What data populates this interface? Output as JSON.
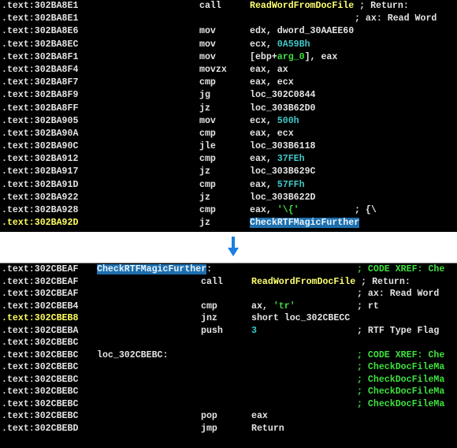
{
  "colors": {
    "background": "#000000",
    "text": "#e4e4e4",
    "function_name": "#ffff70",
    "number": "#40c8c8",
    "comment_green": "#3ee03e",
    "highlight": "#1e6fae",
    "arrow": "#1a7fe0"
  },
  "arrow_icon": "arrow-down-icon",
  "top_listing": [
    {
      "addr": ".text:302BA8E1",
      "mn": "call",
      "ops": [
        {
          "t": "ReadWordFromDocFile",
          "c": "y"
        },
        {
          "t": " ; Return:",
          "c": "w"
        }
      ]
    },
    {
      "addr": ".text:302BA8E1",
      "cm": [
        {
          "t": "; ax: Read Word",
          "c": "w"
        }
      ]
    },
    {
      "addr": ".text:302BA8E6",
      "mn": "mov",
      "ops": [
        {
          "t": "edx, dword_30AAEE60",
          "c": "w"
        }
      ]
    },
    {
      "addr": ".text:302BA8EC",
      "mn": "mov",
      "ops": [
        {
          "t": "ecx, ",
          "c": "w"
        },
        {
          "t": "0A59Bh",
          "c": "cy"
        }
      ]
    },
    {
      "addr": ".text:302BA8F1",
      "mn": "mov",
      "ops": [
        {
          "t": "[ebp+",
          "c": "w"
        },
        {
          "t": "arg_0",
          "c": "g"
        },
        {
          "t": "], eax",
          "c": "w"
        }
      ]
    },
    {
      "addr": ".text:302BA8F4",
      "mn": "movzx",
      "ops": [
        {
          "t": "eax, ax",
          "c": "w"
        }
      ]
    },
    {
      "addr": ".text:302BA8F7",
      "mn": "cmp",
      "ops": [
        {
          "t": "eax, ecx",
          "c": "w"
        }
      ]
    },
    {
      "addr": ".text:302BA8F9",
      "mn": "jg",
      "ops": [
        {
          "t": "loc_302C0844",
          "c": "w"
        }
      ]
    },
    {
      "addr": ".text:302BA8FF",
      "mn": "jz",
      "ops": [
        {
          "t": "loc_303B62D0",
          "c": "w"
        }
      ]
    },
    {
      "addr": ".text:302BA905",
      "mn": "mov",
      "ops": [
        {
          "t": "ecx, ",
          "c": "w"
        },
        {
          "t": "500h",
          "c": "cy"
        }
      ]
    },
    {
      "addr": ".text:302BA90A",
      "mn": "cmp",
      "ops": [
        {
          "t": "eax, ecx",
          "c": "w"
        }
      ]
    },
    {
      "addr": ".text:302BA90C",
      "mn": "jle",
      "ops": [
        {
          "t": "loc_303B6118",
          "c": "w"
        }
      ]
    },
    {
      "addr": ".text:302BA912",
      "mn": "cmp",
      "ops": [
        {
          "t": "eax, ",
          "c": "w"
        },
        {
          "t": "37FEh",
          "c": "cy"
        }
      ]
    },
    {
      "addr": ".text:302BA917",
      "mn": "jz",
      "ops": [
        {
          "t": "loc_303B629C",
          "c": "w"
        }
      ]
    },
    {
      "addr": ".text:302BA91D",
      "mn": "cmp",
      "ops": [
        {
          "t": "eax, ",
          "c": "w"
        },
        {
          "t": "57FFh",
          "c": "cy"
        }
      ]
    },
    {
      "addr": ".text:302BA922",
      "mn": "jz",
      "ops": [
        {
          "t": "loc_303B622D",
          "c": "w"
        }
      ]
    },
    {
      "addr": ".text:302BA928",
      "mn": "cmp",
      "ops": [
        {
          "t": "eax, ",
          "c": "w"
        },
        {
          "t": "'\\{'",
          "c": "g"
        }
      ],
      "cm": [
        {
          "t": "; {\\",
          "c": "w"
        }
      ]
    },
    {
      "addr": ".text:302BA92D",
      "cur": true,
      "mn": "jz",
      "ops": [
        {
          "t": "CheckRTFMagicFurther",
          "c": "hl"
        }
      ]
    }
  ],
  "bottom_listing": [
    {
      "addr": ".text:302CBEAF",
      "lbl": [
        {
          "t": "CheckRTFMagicFurther",
          "c": "hl"
        },
        {
          "t": ":",
          "c": "w"
        }
      ],
      "cm": [
        {
          "t": "; CODE XREF: Che",
          "c": "g"
        }
      ]
    },
    {
      "addr": ".text:302CBEAF",
      "mn": "call",
      "ops": [
        {
          "t": "ReadWordFromDocFile",
          "c": "y"
        },
        {
          "t": " ; Return:",
          "c": "w"
        }
      ]
    },
    {
      "addr": ".text:302CBEAF",
      "cm": [
        {
          "t": "; ax: Read Word",
          "c": "w"
        }
      ]
    },
    {
      "addr": ".text:302CBEB4",
      "mn": "cmp",
      "ops": [
        {
          "t": "ax, ",
          "c": "w"
        },
        {
          "t": "'tr'",
          "c": "g"
        }
      ],
      "cm": [
        {
          "t": "; rt",
          "c": "w"
        }
      ]
    },
    {
      "addr": ".text:302CBEB8",
      "cur": true,
      "mn": "jnz",
      "ops": [
        {
          "t": "short loc_302CBECC",
          "c": "w"
        }
      ]
    },
    {
      "addr": ".text:302CBEBA",
      "mn": "push",
      "ops": [
        {
          "t": "3",
          "c": "cy"
        }
      ],
      "cm": [
        {
          "t": "; RTF Type Flag",
          "c": "w"
        }
      ]
    },
    {
      "addr": ".text:302CBEBC"
    },
    {
      "addr": ".text:302CBEBC",
      "lbl": [
        {
          "t": "loc_302CBEBC:",
          "c": "w"
        }
      ],
      "cm": [
        {
          "t": "; CODE XREF: Che",
          "c": "g"
        }
      ]
    },
    {
      "addr": ".text:302CBEBC",
      "cm": [
        {
          "t": "; CheckDocFileMa",
          "c": "g"
        }
      ]
    },
    {
      "addr": ".text:302CBEBC",
      "cm": [
        {
          "t": "; CheckDocFileMa",
          "c": "g"
        }
      ]
    },
    {
      "addr": ".text:302CBEBC",
      "cm": [
        {
          "t": "; CheckDocFileMa",
          "c": "g"
        }
      ]
    },
    {
      "addr": ".text:302CBEBC",
      "cm": [
        {
          "t": "; CheckDocFileMa",
          "c": "g"
        }
      ]
    },
    {
      "addr": ".text:302CBEBC",
      "mn": "pop",
      "ops": [
        {
          "t": "eax",
          "c": "w"
        }
      ]
    },
    {
      "addr": ".text:302CBEBD",
      "mn": "jmp",
      "ops": [
        {
          "t": "Return",
          "c": "w"
        }
      ]
    }
  ]
}
